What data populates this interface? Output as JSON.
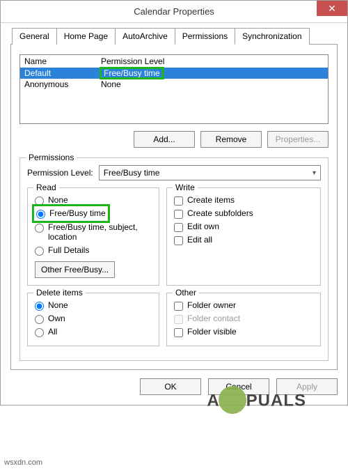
{
  "titlebar": {
    "title": "Calendar Properties"
  },
  "tabs": {
    "general": "General",
    "homepage": "Home Page",
    "autoarchive": "AutoArchive",
    "permissions": "Permissions",
    "synchronization": "Synchronization"
  },
  "list": {
    "header_name": "Name",
    "header_level": "Permission Level",
    "rows": [
      {
        "name": "Default",
        "level": "Free/Busy time"
      },
      {
        "name": "Anonymous",
        "level": "None"
      }
    ]
  },
  "buttons": {
    "add": "Add...",
    "remove": "Remove",
    "properties": "Properties...",
    "ok": "OK",
    "cancel": "Cancel",
    "apply": "Apply",
    "other_freebusy": "Other Free/Busy..."
  },
  "permissions": {
    "legend": "Permissions",
    "level_label": "Permission Level:",
    "level_value": "Free/Busy time",
    "read": {
      "legend": "Read",
      "none": "None",
      "freebusy": "Free/Busy time",
      "freebusy_subject": "Free/Busy time, subject, location",
      "full": "Full Details"
    },
    "write": {
      "legend": "Write",
      "create_items": "Create items",
      "create_subfolders": "Create subfolders",
      "edit_own": "Edit own",
      "edit_all": "Edit all"
    },
    "delete": {
      "legend": "Delete items",
      "none": "None",
      "own": "Own",
      "all": "All"
    },
    "other": {
      "legend": "Other",
      "folder_owner": "Folder owner",
      "folder_contact": "Folder contact",
      "folder_visible": "Folder visible"
    }
  },
  "watermark": {
    "text": "APPUALS",
    "url": "wsxdn.com"
  }
}
